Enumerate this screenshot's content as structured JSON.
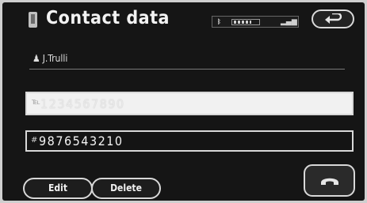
{
  "header": {
    "title": "Contact data",
    "title_icon": "phonebook-icon",
    "back_icon": "return-arrow-icon"
  },
  "status_bar": {
    "bluetooth_icon": "bluetooth-icon",
    "battery_icon": "battery-icon",
    "signal_icon": "signal-strength-icon"
  },
  "contact": {
    "name": "J.Trulli",
    "person_icon": "person-icon"
  },
  "numbers": [
    {
      "icon": "phone-icon",
      "value": "1234567890",
      "selected": true
    },
    {
      "icon": "fax-icon",
      "value": "9876543210",
      "selected": false
    }
  ],
  "buttons": {
    "edit": "Edit",
    "delete": "Delete",
    "call_icon": "handset-icon"
  },
  "colors": {
    "screen_bg": "#151515",
    "selected_field_bg": "#f1f1f1",
    "outline": "#d8d8d8"
  }
}
